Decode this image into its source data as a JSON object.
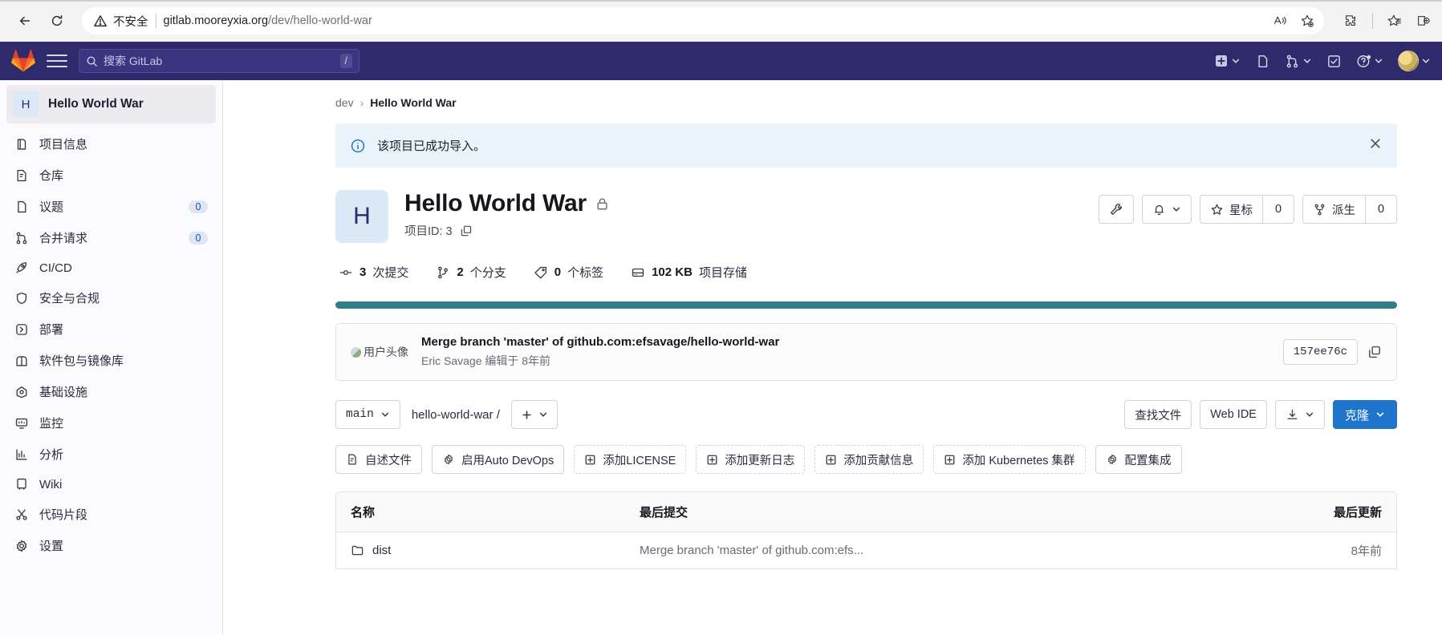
{
  "browser": {
    "back_label": "后退",
    "reload_label": "刷新",
    "security_text": "不安全",
    "url_host": "gitlab.mooreyxia.org",
    "url_path": "/dev/hello-world-war",
    "icons": [
      "read-aloud-icon",
      "add-favorite-icon",
      "extensions-icon",
      "collections-icon",
      "split-screen-icon"
    ]
  },
  "navbar": {
    "search_placeholder": "搜索 GitLab",
    "search_shortcut": "/",
    "items": [
      "create-new-icon",
      "issues-icon",
      "merge-requests-icon",
      "todos-icon",
      "help-icon",
      "user-avatar"
    ]
  },
  "sidebar": {
    "project_initial": "H",
    "project_name": "Hello World War",
    "items": [
      {
        "icon": "project-information-icon",
        "label": "项目信息",
        "badge": ""
      },
      {
        "icon": "repository-icon",
        "label": "仓库",
        "badge": ""
      },
      {
        "icon": "issues-icon",
        "label": "议题",
        "badge": "0"
      },
      {
        "icon": "merge-requests-icon",
        "label": "合并请求",
        "badge": "0"
      },
      {
        "icon": "rocket-icon",
        "label": "CI/CD",
        "badge": ""
      },
      {
        "icon": "shield-icon",
        "label": "安全与合规",
        "badge": ""
      },
      {
        "icon": "deploy-icon",
        "label": "部署",
        "badge": ""
      },
      {
        "icon": "package-icon",
        "label": "软件包与镜像库",
        "badge": ""
      },
      {
        "icon": "infrastructure-icon",
        "label": "基础设施",
        "badge": ""
      },
      {
        "icon": "monitor-icon",
        "label": "监控",
        "badge": ""
      },
      {
        "icon": "analytics-icon",
        "label": "分析",
        "badge": ""
      },
      {
        "icon": "wiki-icon",
        "label": "Wiki",
        "badge": ""
      },
      {
        "icon": "snippets-icon",
        "label": "代码片段",
        "badge": ""
      },
      {
        "icon": "gear-icon",
        "label": "设置",
        "badge": ""
      }
    ]
  },
  "breadcrumb": {
    "root": "dev",
    "separator": "›",
    "current": "Hello World War"
  },
  "alert": {
    "message": "该项目已成功导入。",
    "info_icon": "info-icon",
    "close_icon": "close-icon"
  },
  "project": {
    "initial": "H",
    "title": "Hello World War",
    "visibility_icon": "lock-icon",
    "id_label": "项目ID: 3",
    "copy_icon": "copy-icon"
  },
  "header_actions": {
    "wrench_icon": "wrench-icon",
    "notifications_icon": "bell-icon",
    "star_label": "星标",
    "star_count": "0",
    "fork_label": "派生",
    "fork_count": "0"
  },
  "stats": [
    {
      "icon": "commit-icon",
      "value": "3",
      "label": "次提交"
    },
    {
      "icon": "branch-icon",
      "value": "2",
      "label": "个分支"
    },
    {
      "icon": "tag-icon",
      "value": "0",
      "label": "个标签"
    },
    {
      "icon": "storage-icon",
      "value": "102 KB",
      "label": "项目存储"
    }
  ],
  "language_bar_color": "#2f7f88",
  "commit": {
    "avatar_alt": "用户头像",
    "message": "Merge branch 'master' of github.com:efsavage/hello-world-war",
    "author": "Eric Savage",
    "meta": "编辑于 8年前",
    "sha": "157ee76c",
    "copy_icon": "copy-icon"
  },
  "file_toolbar": {
    "branch": "main",
    "path": "hello-world-war",
    "path_separator": "/",
    "add_icon": "plus-icon",
    "find_file": "查找文件",
    "web_ide": "Web IDE",
    "download_icon": "download-icon",
    "clone_label": "克隆"
  },
  "quick_actions": [
    {
      "icon": "file-icon",
      "label": "自述文件",
      "dashed": false
    },
    {
      "icon": "gear-icon",
      "label": "启用Auto DevOps",
      "dashed": false
    },
    {
      "icon": "plus-box-icon",
      "label": "添加LICENSE",
      "dashed": true
    },
    {
      "icon": "plus-box-icon",
      "label": "添加更新日志",
      "dashed": true
    },
    {
      "icon": "plus-box-icon",
      "label": "添加贡献信息",
      "dashed": true
    },
    {
      "icon": "plus-box-icon",
      "label": "添加 Kubernetes 集群",
      "dashed": true
    },
    {
      "icon": "gear-icon",
      "label": "配置集成",
      "dashed": false
    }
  ],
  "file_table": {
    "columns": {
      "name": "名称",
      "commit": "最后提交",
      "updated": "最后更新"
    },
    "rows": [
      {
        "icon": "folder-icon",
        "name": "dist",
        "commit": "Merge branch 'master' of github.com:efs...",
        "updated": "8年前"
      }
    ]
  }
}
